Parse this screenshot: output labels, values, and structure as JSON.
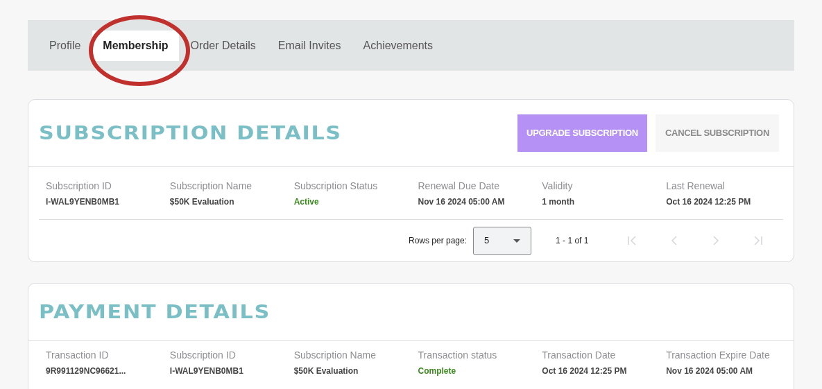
{
  "tabs": [
    {
      "label": "Profile",
      "selected": false
    },
    {
      "label": "Membership",
      "selected": true
    },
    {
      "label": "Order Details",
      "selected": false
    },
    {
      "label": "Email Invites",
      "selected": false
    },
    {
      "label": "Achievements",
      "selected": false
    }
  ],
  "subscription": {
    "title": "SUBSCRIPTION DETAILS",
    "buttons": [
      {
        "label": "UPGRADE SUBSCRIPTION",
        "kind": "primary"
      },
      {
        "label": "CANCEL SUBSCRIPTION",
        "kind": "secondary"
      }
    ],
    "fields": [
      {
        "label": "Subscription ID",
        "value": "I-WAL9YENB0MB1",
        "kind": "plain"
      },
      {
        "label": "Subscription Name",
        "value": "$50K Evaluation",
        "kind": "plain"
      },
      {
        "label": "Subscription Status",
        "value": "Active",
        "kind": "status"
      },
      {
        "label": "Renewal Due Date",
        "value": "Nov 16 2024 05:00 AM",
        "kind": "plain"
      },
      {
        "label": "Validity",
        "value": "1 month",
        "kind": "plain"
      },
      {
        "label": "Last Renewal",
        "value": "Oct 16 2024 12:25 PM",
        "kind": "plain"
      }
    ],
    "pagination": {
      "rows_label": "Rows per page:",
      "rows_value": "5",
      "range": "1 - 1 of 1"
    }
  },
  "payment": {
    "title": "PAYMENT DETAILS",
    "fields": [
      {
        "label": "Transaction ID",
        "value": "9R991129NC96621...",
        "kind": "plain"
      },
      {
        "label": "Subscription ID",
        "value": "I-WAL9YENB0MB1",
        "kind": "plain"
      },
      {
        "label": "Subscription Name",
        "value": "$50K Evaluation",
        "kind": "plain"
      },
      {
        "label": "Transaction status",
        "value": "Complete",
        "kind": "status"
      },
      {
        "label": "Transaction Date",
        "value": "Oct 16 2024 12:25 PM",
        "kind": "plain"
      },
      {
        "label": "Transaction Expire Date",
        "value": "Nov 16 2024 05:00 AM",
        "kind": "plain"
      }
    ]
  }
}
